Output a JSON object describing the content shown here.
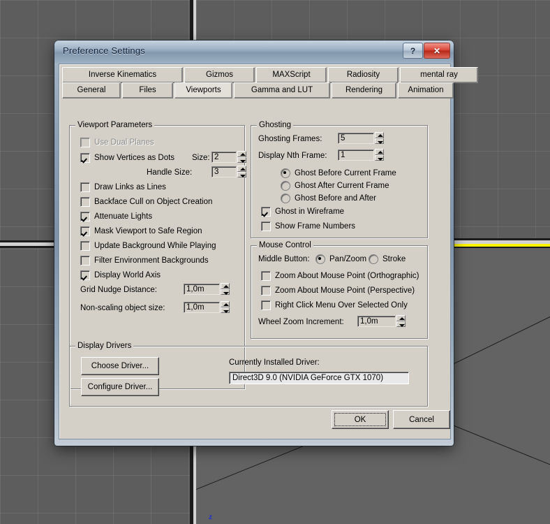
{
  "background": {
    "app": "3ds Max viewport",
    "axis_label_z": "z",
    "selected_viewport_border_color": "#fcf500",
    "grid_color": "#5d5d5d"
  },
  "window": {
    "title": "Preference Settings",
    "help_button": "?",
    "close_button": "✕"
  },
  "tabs": {
    "row1": [
      {
        "label": "Inverse Kinematics",
        "selected": false
      },
      {
        "label": "Gizmos",
        "selected": false
      },
      {
        "label": "MAXScript",
        "selected": false
      },
      {
        "label": "Radiosity",
        "selected": false
      },
      {
        "label": "mental ray",
        "selected": false
      }
    ],
    "row2": [
      {
        "label": "General",
        "selected": false
      },
      {
        "label": "Files",
        "selected": false
      },
      {
        "label": "Viewports",
        "selected": true
      },
      {
        "label": "Gamma and LUT",
        "selected": false
      },
      {
        "label": "Rendering",
        "selected": false
      },
      {
        "label": "Animation",
        "selected": false
      }
    ]
  },
  "viewport_parameters": {
    "title": "Viewport Parameters",
    "checkboxes": [
      {
        "label": "Use Dual Planes",
        "checked": false,
        "disabled": true
      },
      {
        "label": "Show Vertices as Dots",
        "checked": true,
        "disabled": false
      },
      {
        "label": "Draw Links as Lines",
        "checked": false,
        "disabled": false
      },
      {
        "label": "Backface Cull on Object Creation",
        "checked": false,
        "disabled": false
      },
      {
        "label": "Attenuate Lights",
        "checked": true,
        "disabled": false
      },
      {
        "label": "Mask Viewport to Safe Region",
        "checked": true,
        "disabled": false
      },
      {
        "label": "Update Background While Playing",
        "checked": false,
        "disabled": false
      },
      {
        "label": "Filter Environment Backgrounds",
        "checked": false,
        "disabled": false
      },
      {
        "label": "Display World Axis",
        "checked": true,
        "disabled": false
      }
    ],
    "size_label": "Size:",
    "size_value": "2",
    "handle_size_label": "Handle Size:",
    "handle_size_value": "3",
    "grid_nudge_label": "Grid Nudge Distance:",
    "grid_nudge_value": "1,0m",
    "non_scaling_label": "Non-scaling object size:",
    "non_scaling_value": "1,0m"
  },
  "ghosting": {
    "title": "Ghosting",
    "frames_label": "Ghosting Frames:",
    "frames_value": "5",
    "nth_label": "Display Nth Frame:",
    "nth_value": "1",
    "radios": [
      {
        "label": "Ghost Before Current Frame",
        "checked": true
      },
      {
        "label": "Ghost After Current Frame",
        "checked": false
      },
      {
        "label": "Ghost Before and After",
        "checked": false
      }
    ],
    "checkboxes": [
      {
        "label": "Ghost in Wireframe",
        "checked": true
      },
      {
        "label": "Show Frame Numbers",
        "checked": false
      }
    ]
  },
  "mouse_control": {
    "title": "Mouse Control",
    "middle_button_label": "Middle Button:",
    "radios": [
      {
        "label": "Pan/Zoom",
        "checked": true
      },
      {
        "label": "Stroke",
        "checked": false
      }
    ],
    "checkboxes": [
      {
        "label": "Zoom About Mouse Point (Orthographic)",
        "checked": false
      },
      {
        "label": "Zoom About Mouse Point (Perspective)",
        "checked": false
      },
      {
        "label": "Right Click Menu Over Selected Only",
        "checked": false
      }
    ],
    "wheel_label": "Wheel Zoom Increment:",
    "wheel_value": "1,0m"
  },
  "display_drivers": {
    "title": "Display Drivers",
    "choose_button": "Choose Driver...",
    "configure_button": "Configure Driver...",
    "currently_installed_label": "Currently Installed Driver:",
    "driver_value": "Direct3D 9.0 (NVIDIA GeForce GTX 1070)"
  },
  "footer": {
    "ok_button": "OK",
    "cancel_button": "Cancel"
  }
}
